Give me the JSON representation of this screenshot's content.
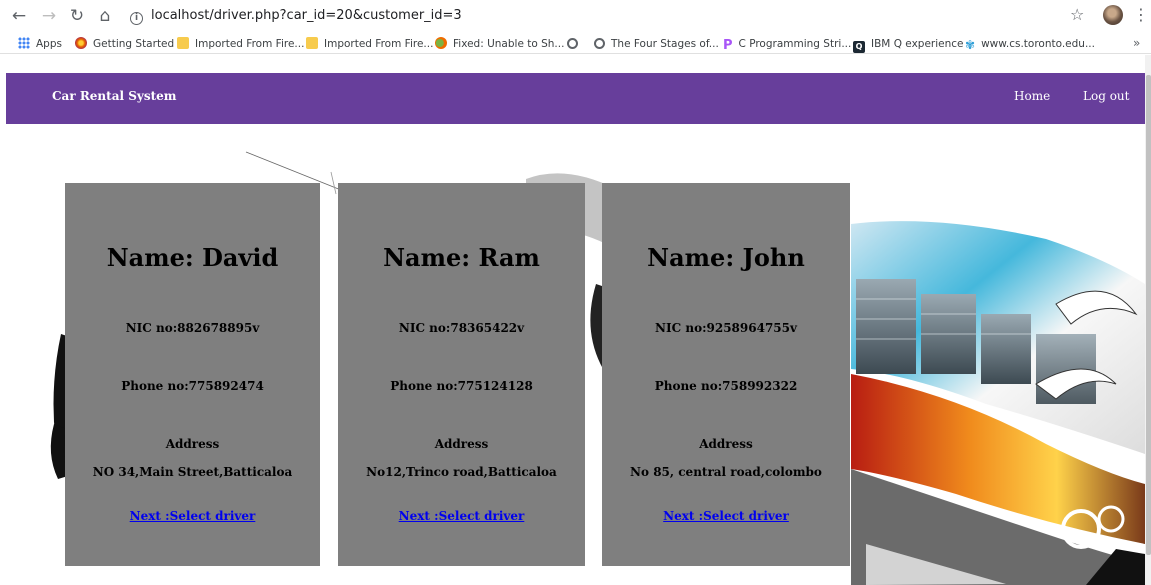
{
  "browser": {
    "url": "localhost/driver.php?car_id=20&customer_id=3",
    "bookmarks": [
      {
        "label": "Apps",
        "icon": "apps-grid-icon"
      },
      {
        "label": "Getting Started",
        "icon": "firefox-icon"
      },
      {
        "label": "Imported From Fire...",
        "icon": "folder-icon"
      },
      {
        "label": "Imported From Fire...",
        "icon": "folder-icon"
      },
      {
        "label": "Fixed: Unable to Sh...",
        "icon": "site-icon"
      },
      {
        "label": "",
        "icon": "globe-icon"
      },
      {
        "label": "The Four Stages of...",
        "icon": "globe-icon"
      },
      {
        "label": "C Programming Stri...",
        "icon": "c-logo-icon"
      },
      {
        "label": "IBM Q experience",
        "icon": "ibm-q-icon"
      },
      {
        "label": "www.cs.toronto.edu...",
        "icon": "toronto-icon"
      }
    ]
  },
  "navbar": {
    "brand": "Car Rental System",
    "home": "Home",
    "logout": "Log out",
    "color": "#673e9b"
  },
  "drivers": [
    {
      "name": "Name: David",
      "nic": "NIC no:882678895v",
      "phone": "Phone no:775892474",
      "address_heading": "Address",
      "address": "NO 34,Main Street,Batticaloa",
      "link": "Next :Select driver"
    },
    {
      "name": "Name: Ram",
      "nic": "NIC no:78365422v",
      "phone": "Phone no:775124128",
      "address_heading": "Address",
      "address": "No12,Trinco road,Batticaloa",
      "link": "Next :Select driver"
    },
    {
      "name": "Name: John",
      "nic": "NIC no:9258964755v",
      "phone": "Phone no:758992322",
      "address_heading": "Address",
      "address": "No 85, central road,colombo",
      "link": "Next :Select driver"
    }
  ],
  "colors": {
    "card_bg": "#7f7f7f",
    "link": "#0000ee"
  }
}
